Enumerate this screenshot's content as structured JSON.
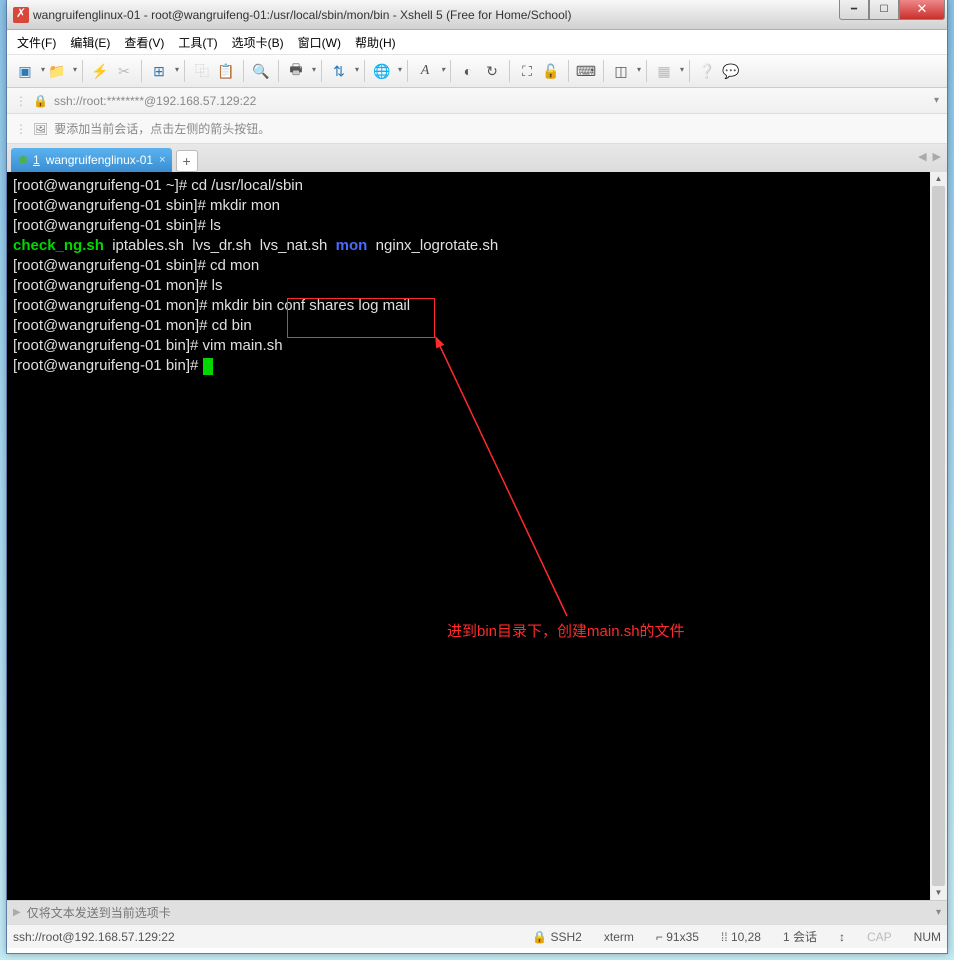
{
  "title": "wangruifenglinux-01 - root@wangruifeng-01:/usr/local/sbin/mon/bin - Xshell 5 (Free for Home/School)",
  "menubar": [
    "文件(F)",
    "编辑(E)",
    "查看(V)",
    "工具(T)",
    "选项卡(B)",
    "窗口(W)",
    "帮助(H)"
  ],
  "address": "ssh://root:********@192.168.57.129:22",
  "hint": "要添加当前会话，点击左侧的箭头按钮。",
  "tab": {
    "prefix": "1",
    "name": "wangruifenglinux-01"
  },
  "tab_add": "+",
  "terminal": {
    "lines": [
      {
        "t": "prompt",
        "p": "[root@wangruifeng-01 ~]# ",
        "c": "cd /usr/local/sbin"
      },
      {
        "t": "prompt",
        "p": "[root@wangruifeng-01 sbin]# ",
        "c": "mkdir mon"
      },
      {
        "t": "prompt",
        "p": "[root@wangruifeng-01 sbin]# ",
        "c": "ls"
      },
      {
        "t": "ls1"
      },
      {
        "t": "prompt",
        "p": "[root@wangruifeng-01 sbin]# ",
        "c": "cd mon"
      },
      {
        "t": "prompt",
        "p": "[root@wangruifeng-01 mon]# ",
        "c": "ls"
      },
      {
        "t": "prompt",
        "p": "[root@wangruifeng-01 mon]# ",
        "c": "mkdir bin conf shares log mail"
      },
      {
        "t": "prompt",
        "p": "[root@wangruifeng-01 mon]# ",
        "c": "cd bin"
      },
      {
        "t": "prompt",
        "p": "[root@wangruifeng-01 bin]# ",
        "c": "vim main.sh"
      },
      {
        "t": "cursor",
        "p": "[root@wangruifeng-01 bin]# "
      }
    ],
    "ls1": {
      "a": "check_ng.sh",
      "b": "  iptables.sh  lvs_dr.sh  lvs_nat.sh  ",
      "c": "mon",
      "d": "  nginx_logrotate.sh"
    }
  },
  "annotation": "进到bin目录下，创建main.sh的文件",
  "cmdbar_placeholder": "仅将文本发送到当前选项卡",
  "statusbar": {
    "left": "ssh://root@192.168.57.129:22",
    "proto": "SSH2",
    "term": "xterm",
    "size": "91x35",
    "pos": "10,28",
    "sess": "1 会话",
    "cap": "CAP",
    "num": "NUM",
    "size_pre": "⌐",
    "pos_pre": "⁞⁞",
    "proto_pre": "🔒",
    "sess_pre": "↕"
  },
  "icons": {
    "lock": "🔒",
    "arrow": "➦",
    "send": "▶",
    "dd": "▾"
  }
}
